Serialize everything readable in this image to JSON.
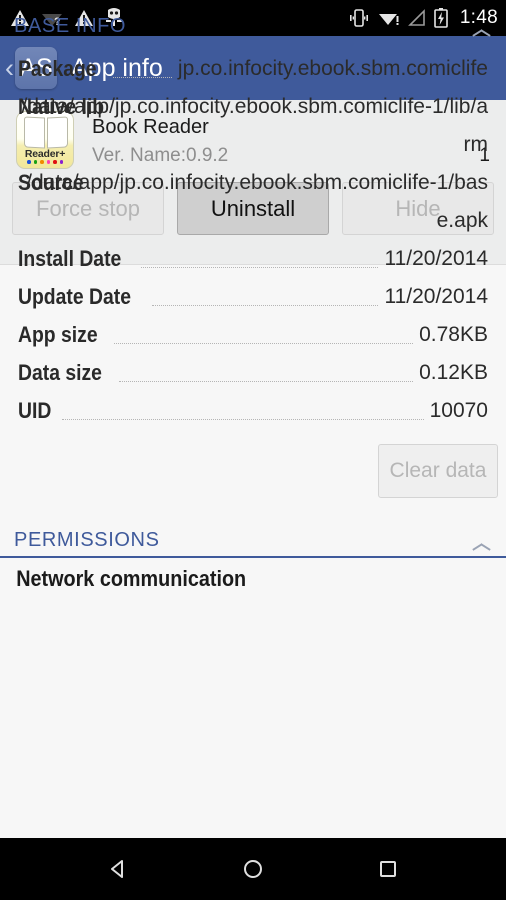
{
  "statusbar": {
    "time": "1:48",
    "left_icons": [
      "warning-triangle-icon",
      "wifi-question-icon",
      "warning-triangle-icon",
      "android-robot-icon"
    ],
    "right_icons": [
      "vibrate-icon",
      "wifi-alert-icon",
      "signal-empty-icon",
      "battery-charging-icon"
    ]
  },
  "actionbar": {
    "back_glyph": "‹",
    "logo_text": "AS",
    "title": "App info"
  },
  "app": {
    "name": "Book Reader",
    "version": "Ver. Name:0.9.2",
    "version_code": "1",
    "icon_label": "Reader+",
    "icon_dot_colors": [
      "#1c4fd8",
      "#17a014",
      "#f08a00",
      "#ff3fb0",
      "#e01010",
      "#8a1fd0"
    ],
    "buttons": [
      {
        "label": "Force stop",
        "enabled": false
      },
      {
        "label": "Uninstall",
        "enabled": true
      },
      {
        "label": "Hide",
        "enabled": false
      }
    ]
  },
  "base_info": {
    "title": "BASE INFO",
    "rows": [
      {
        "label": "Package",
        "value": "jp.co.infocity.ebook.sbm.comiclife"
      },
      {
        "label": "Native lib",
        "value": "/data/app/jp.co.infocity.ebook.sbm.comiclife-1/lib/arm"
      },
      {
        "label": "Source",
        "value": "/data/app/jp.co.infocity.ebook.sbm.comiclife-1/base.apk"
      },
      {
        "label": "Install Date",
        "value": "11/20/2014"
      },
      {
        "label": "Update Date",
        "value": "11/20/2014"
      },
      {
        "label": "App size",
        "value": "0.78KB"
      },
      {
        "label": "Data size",
        "value": "0.12KB"
      },
      {
        "label": "UID",
        "value": "10070"
      }
    ],
    "clear_data_label": "Clear data"
  },
  "permissions": {
    "title": "PERMISSIONS",
    "first_item": "Network communication"
  },
  "navbar": {
    "back": "back-triangle-icon",
    "home": "home-circle-icon",
    "recents": "recents-square-icon"
  },
  "colors": {
    "accent": "#3f5a9b",
    "statusbar": "#000000",
    "background": "#f7f7f7",
    "header_bg": "#eceded"
  }
}
